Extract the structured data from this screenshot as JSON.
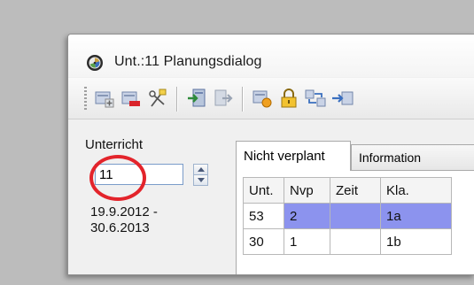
{
  "window": {
    "title": "Unt.:11  Planungsdialog",
    "app_icon": "clock-icon"
  },
  "toolbar": {
    "buttons": [
      {
        "name": "new-lesson-icon"
      },
      {
        "name": "delete-lesson-icon"
      },
      {
        "name": "split-lesson-icon"
      },
      {
        "name": "import-icon"
      },
      {
        "name": "export-icon"
      },
      {
        "name": "edit-lesson-icon"
      },
      {
        "name": "lock-icon"
      },
      {
        "name": "swap-icon"
      },
      {
        "name": "move-icon"
      }
    ]
  },
  "lesson_panel": {
    "label": "Unterricht",
    "lesson_number": "11",
    "date_from": "19.9.2012 -",
    "date_to": "30.6.2013",
    "highlight_color": "#e3242b"
  },
  "tabs": [
    {
      "label": "Nicht verplant",
      "active": true
    },
    {
      "label": "Information",
      "active": false
    }
  ],
  "table": {
    "columns": [
      "Unt.",
      "Nvp",
      "Zeit",
      "Kla."
    ],
    "rows": [
      [
        "53",
        "2",
        "",
        "1a"
      ],
      [
        "30",
        "1",
        "",
        "1b"
      ]
    ],
    "selection_color": "#8c93ee"
  }
}
